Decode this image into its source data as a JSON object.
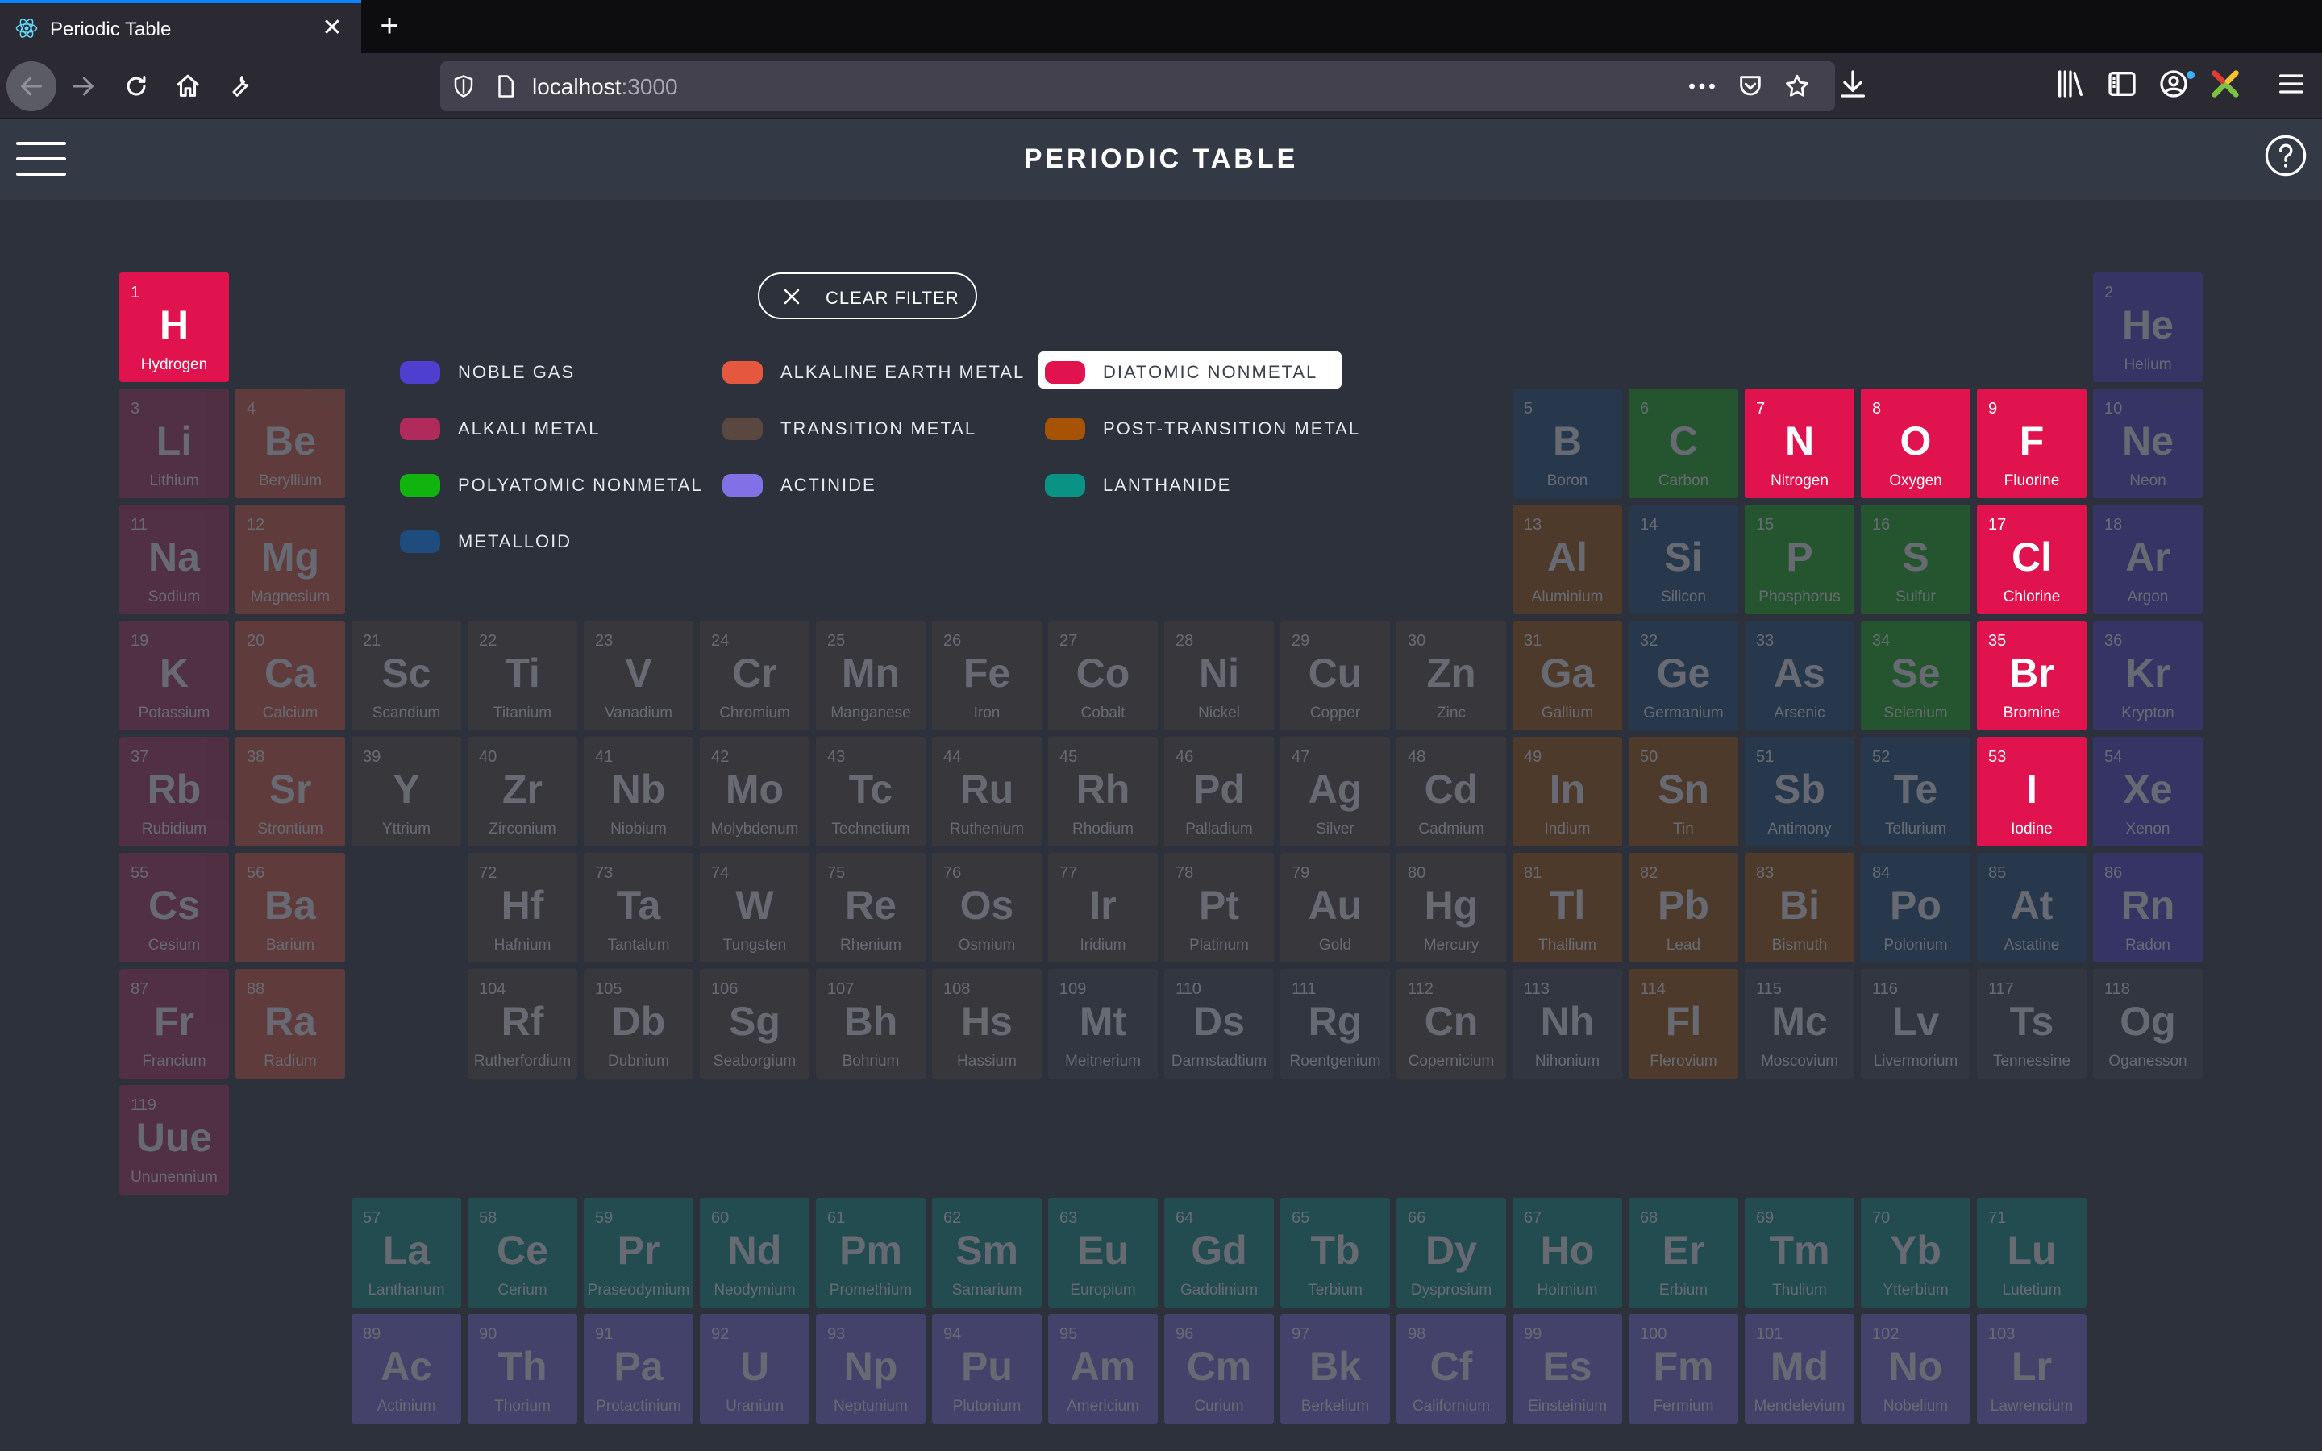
{
  "browser": {
    "tab_title": "Periodic Table",
    "url_host": "localhost",
    "url_port": ":3000"
  },
  "app": {
    "title": "PERIODIC TABLE",
    "menu_icon": "hamburger-icon",
    "help_icon": "help-icon"
  },
  "filter": {
    "clear_label": "CLEAR FILTER",
    "active_category": "DIATOMIC NONMETAL"
  },
  "legend": [
    {
      "label": "NOBLE GAS",
      "color": "#4f3fd0"
    },
    {
      "label": "ALKALINE EARTH METAL",
      "color": "#e5583f"
    },
    {
      "label": "DIATOMIC NONMETAL",
      "color": "#e0134e"
    },
    {
      "label": "ALKALI METAL",
      "color": "#b02a5b"
    },
    {
      "label": "TRANSITION METAL",
      "color": "#5a4840"
    },
    {
      "label": "POST-TRANSITION METAL",
      "color": "#a65305"
    },
    {
      "label": "POLYATOMIC NONMETAL",
      "color": "#11b30e"
    },
    {
      "label": "ACTINIDE",
      "color": "#8270e6"
    },
    {
      "label": "LANTHANIDE",
      "color": "#0a9384"
    },
    {
      "label": "METALLOID",
      "color": "#1d4c7d"
    }
  ],
  "category_colors": {
    "noble": "#4f3fd0",
    "alkaline": "#e5583f",
    "diatomic": "#e0134e",
    "alkali": "#b02a5b",
    "transition": "#5a4840",
    "post": "#a65305",
    "polyatomic": "#11b30e",
    "actinide": "#8270e6",
    "lanthanide": "#0a9384",
    "metalloid": "#1d4c7d",
    "unknown": "#3f4552"
  },
  "elements": [
    {
      "n": 1,
      "s": "H",
      "name": "Hydrogen",
      "c": "diatomic",
      "hl": true
    },
    {
      "n": 2,
      "s": "He",
      "name": "Helium",
      "c": "noble"
    },
    {
      "n": 3,
      "s": "Li",
      "name": "Lithium",
      "c": "alkali"
    },
    {
      "n": 4,
      "s": "Be",
      "name": "Beryllium",
      "c": "alkaline"
    },
    {
      "n": 5,
      "s": "B",
      "name": "Boron",
      "c": "metalloid"
    },
    {
      "n": 6,
      "s": "C",
      "name": "Carbon",
      "c": "polyatomic"
    },
    {
      "n": 7,
      "s": "N",
      "name": "Nitrogen",
      "c": "diatomic",
      "hl": true
    },
    {
      "n": 8,
      "s": "O",
      "name": "Oxygen",
      "c": "diatomic",
      "hl": true
    },
    {
      "n": 9,
      "s": "F",
      "name": "Fluorine",
      "c": "diatomic",
      "hl": true
    },
    {
      "n": 10,
      "s": "Ne",
      "name": "Neon",
      "c": "noble"
    },
    {
      "n": 11,
      "s": "Na",
      "name": "Sodium",
      "c": "alkali"
    },
    {
      "n": 12,
      "s": "Mg",
      "name": "Magnesium",
      "c": "alkaline"
    },
    {
      "n": 13,
      "s": "Al",
      "name": "Aluminium",
      "c": "post"
    },
    {
      "n": 14,
      "s": "Si",
      "name": "Silicon",
      "c": "metalloid"
    },
    {
      "n": 15,
      "s": "P",
      "name": "Phosphorus",
      "c": "polyatomic"
    },
    {
      "n": 16,
      "s": "S",
      "name": "Sulfur",
      "c": "polyatomic"
    },
    {
      "n": 17,
      "s": "Cl",
      "name": "Chlorine",
      "c": "diatomic",
      "hl": true
    },
    {
      "n": 18,
      "s": "Ar",
      "name": "Argon",
      "c": "noble"
    },
    {
      "n": 19,
      "s": "K",
      "name": "Potassium",
      "c": "alkali"
    },
    {
      "n": 20,
      "s": "Ca",
      "name": "Calcium",
      "c": "alkaline"
    },
    {
      "n": 21,
      "s": "Sc",
      "name": "Scandium",
      "c": "transition"
    },
    {
      "n": 22,
      "s": "Ti",
      "name": "Titanium",
      "c": "transition"
    },
    {
      "n": 23,
      "s": "V",
      "name": "Vanadium",
      "c": "transition"
    },
    {
      "n": 24,
      "s": "Cr",
      "name": "Chromium",
      "c": "transition"
    },
    {
      "n": 25,
      "s": "Mn",
      "name": "Manganese",
      "c": "transition"
    },
    {
      "n": 26,
      "s": "Fe",
      "name": "Iron",
      "c": "transition"
    },
    {
      "n": 27,
      "s": "Co",
      "name": "Cobalt",
      "c": "transition"
    },
    {
      "n": 28,
      "s": "Ni",
      "name": "Nickel",
      "c": "transition"
    },
    {
      "n": 29,
      "s": "Cu",
      "name": "Copper",
      "c": "transition"
    },
    {
      "n": 30,
      "s": "Zn",
      "name": "Zinc",
      "c": "transition"
    },
    {
      "n": 31,
      "s": "Ga",
      "name": "Gallium",
      "c": "post"
    },
    {
      "n": 32,
      "s": "Ge",
      "name": "Germanium",
      "c": "metalloid"
    },
    {
      "n": 33,
      "s": "As",
      "name": "Arsenic",
      "c": "metalloid"
    },
    {
      "n": 34,
      "s": "Se",
      "name": "Selenium",
      "c": "polyatomic"
    },
    {
      "n": 35,
      "s": "Br",
      "name": "Bromine",
      "c": "diatomic",
      "hl": true
    },
    {
      "n": 36,
      "s": "Kr",
      "name": "Krypton",
      "c": "noble"
    },
    {
      "n": 37,
      "s": "Rb",
      "name": "Rubidium",
      "c": "alkali"
    },
    {
      "n": 38,
      "s": "Sr",
      "name": "Strontium",
      "c": "alkaline"
    },
    {
      "n": 39,
      "s": "Y",
      "name": "Yttrium",
      "c": "transition"
    },
    {
      "n": 40,
      "s": "Zr",
      "name": "Zirconium",
      "c": "transition"
    },
    {
      "n": 41,
      "s": "Nb",
      "name": "Niobium",
      "c": "transition"
    },
    {
      "n": 42,
      "s": "Mo",
      "name": "Molybdenum",
      "c": "transition"
    },
    {
      "n": 43,
      "s": "Tc",
      "name": "Technetium",
      "c": "transition"
    },
    {
      "n": 44,
      "s": "Ru",
      "name": "Ruthenium",
      "c": "transition"
    },
    {
      "n": 45,
      "s": "Rh",
      "name": "Rhodium",
      "c": "transition"
    },
    {
      "n": 46,
      "s": "Pd",
      "name": "Palladium",
      "c": "transition"
    },
    {
      "n": 47,
      "s": "Ag",
      "name": "Silver",
      "c": "transition"
    },
    {
      "n": 48,
      "s": "Cd",
      "name": "Cadmium",
      "c": "transition"
    },
    {
      "n": 49,
      "s": "In",
      "name": "Indium",
      "c": "post"
    },
    {
      "n": 50,
      "s": "Sn",
      "name": "Tin",
      "c": "post"
    },
    {
      "n": 51,
      "s": "Sb",
      "name": "Antimony",
      "c": "metalloid"
    },
    {
      "n": 52,
      "s": "Te",
      "name": "Tellurium",
      "c": "metalloid"
    },
    {
      "n": 53,
      "s": "I",
      "name": "Iodine",
      "c": "diatomic",
      "hl": true
    },
    {
      "n": 54,
      "s": "Xe",
      "name": "Xenon",
      "c": "noble"
    },
    {
      "n": 55,
      "s": "Cs",
      "name": "Cesium",
      "c": "alkali"
    },
    {
      "n": 56,
      "s": "Ba",
      "name": "Barium",
      "c": "alkaline"
    },
    {
      "n": 72,
      "s": "Hf",
      "name": "Hafnium",
      "c": "transition"
    },
    {
      "n": 73,
      "s": "Ta",
      "name": "Tantalum",
      "c": "transition"
    },
    {
      "n": 74,
      "s": "W",
      "name": "Tungsten",
      "c": "transition"
    },
    {
      "n": 75,
      "s": "Re",
      "name": "Rhenium",
      "c": "transition"
    },
    {
      "n": 76,
      "s": "Os",
      "name": "Osmium",
      "c": "transition"
    },
    {
      "n": 77,
      "s": "Ir",
      "name": "Iridium",
      "c": "transition"
    },
    {
      "n": 78,
      "s": "Pt",
      "name": "Platinum",
      "c": "transition"
    },
    {
      "n": 79,
      "s": "Au",
      "name": "Gold",
      "c": "transition"
    },
    {
      "n": 80,
      "s": "Hg",
      "name": "Mercury",
      "c": "transition"
    },
    {
      "n": 81,
      "s": "Tl",
      "name": "Thallium",
      "c": "post"
    },
    {
      "n": 82,
      "s": "Pb",
      "name": "Lead",
      "c": "post"
    },
    {
      "n": 83,
      "s": "Bi",
      "name": "Bismuth",
      "c": "post"
    },
    {
      "n": 84,
      "s": "Po",
      "name": "Polonium",
      "c": "metalloid"
    },
    {
      "n": 85,
      "s": "At",
      "name": "Astatine",
      "c": "metalloid"
    },
    {
      "n": 86,
      "s": "Rn",
      "name": "Radon",
      "c": "noble"
    },
    {
      "n": 87,
      "s": "Fr",
      "name": "Francium",
      "c": "alkali"
    },
    {
      "n": 88,
      "s": "Ra",
      "name": "Radium",
      "c": "alkaline"
    },
    {
      "n": 104,
      "s": "Rf",
      "name": "Rutherfordium",
      "c": "transition"
    },
    {
      "n": 105,
      "s": "Db",
      "name": "Dubnium",
      "c": "transition"
    },
    {
      "n": 106,
      "s": "Sg",
      "name": "Seaborgium",
      "c": "transition"
    },
    {
      "n": 107,
      "s": "Bh",
      "name": "Bohrium",
      "c": "transition"
    },
    {
      "n": 108,
      "s": "Hs",
      "name": "Hassium",
      "c": "transition"
    },
    {
      "n": 109,
      "s": "Mt",
      "name": "Meitnerium",
      "c": "unknown"
    },
    {
      "n": 110,
      "s": "Ds",
      "name": "Darmstadtium",
      "c": "unknown"
    },
    {
      "n": 111,
      "s": "Rg",
      "name": "Roentgenium",
      "c": "unknown"
    },
    {
      "n": 112,
      "s": "Cn",
      "name": "Copernicium",
      "c": "transition"
    },
    {
      "n": 113,
      "s": "Nh",
      "name": "Nihonium",
      "c": "unknown"
    },
    {
      "n": 114,
      "s": "Fl",
      "name": "Flerovium",
      "c": "post"
    },
    {
      "n": 115,
      "s": "Mc",
      "name": "Moscovium",
      "c": "unknown"
    },
    {
      "n": 116,
      "s": "Lv",
      "name": "Livermorium",
      "c": "unknown"
    },
    {
      "n": 117,
      "s": "Ts",
      "name": "Tennessine",
      "c": "unknown"
    },
    {
      "n": 118,
      "s": "Og",
      "name": "Oganesson",
      "c": "unknown"
    },
    {
      "n": 119,
      "s": "Uue",
      "name": "Ununennium",
      "c": "alkali"
    },
    {
      "n": 57,
      "s": "La",
      "name": "Lanthanum",
      "c": "lanthanide"
    },
    {
      "n": 58,
      "s": "Ce",
      "name": "Cerium",
      "c": "lanthanide"
    },
    {
      "n": 59,
      "s": "Pr",
      "name": "Praseodymium",
      "c": "lanthanide"
    },
    {
      "n": 60,
      "s": "Nd",
      "name": "Neodymium",
      "c": "lanthanide"
    },
    {
      "n": 61,
      "s": "Pm",
      "name": "Promethium",
      "c": "lanthanide"
    },
    {
      "n": 62,
      "s": "Sm",
      "name": "Samarium",
      "c": "lanthanide"
    },
    {
      "n": 63,
      "s": "Eu",
      "name": "Europium",
      "c": "lanthanide"
    },
    {
      "n": 64,
      "s": "Gd",
      "name": "Gadolinium",
      "c": "lanthanide"
    },
    {
      "n": 65,
      "s": "Tb",
      "name": "Terbium",
      "c": "lanthanide"
    },
    {
      "n": 66,
      "s": "Dy",
      "name": "Dysprosium",
      "c": "lanthanide"
    },
    {
      "n": 67,
      "s": "Ho",
      "name": "Holmium",
      "c": "lanthanide"
    },
    {
      "n": 68,
      "s": "Er",
      "name": "Erbium",
      "c": "lanthanide"
    },
    {
      "n": 69,
      "s": "Tm",
      "name": "Thulium",
      "c": "lanthanide"
    },
    {
      "n": 70,
      "s": "Yb",
      "name": "Ytterbium",
      "c": "lanthanide"
    },
    {
      "n": 71,
      "s": "Lu",
      "name": "Lutetium",
      "c": "lanthanide"
    },
    {
      "n": 89,
      "s": "Ac",
      "name": "Actinium",
      "c": "actinide"
    },
    {
      "n": 90,
      "s": "Th",
      "name": "Thorium",
      "c": "actinide"
    },
    {
      "n": 91,
      "s": "Pa",
      "name": "Protactinium",
      "c": "actinide"
    },
    {
      "n": 92,
      "s": "U",
      "name": "Uranium",
      "c": "actinide"
    },
    {
      "n": 93,
      "s": "Np",
      "name": "Neptunium",
      "c": "actinide"
    },
    {
      "n": 94,
      "s": "Pu",
      "name": "Plutonium",
      "c": "actinide"
    },
    {
      "n": 95,
      "s": "Am",
      "name": "Americium",
      "c": "actinide"
    },
    {
      "n": 96,
      "s": "Cm",
      "name": "Curium",
      "c": "actinide"
    },
    {
      "n": 97,
      "s": "Bk",
      "name": "Berkelium",
      "c": "actinide"
    },
    {
      "n": 98,
      "s": "Cf",
      "name": "Californium",
      "c": "actinide"
    },
    {
      "n": 99,
      "s": "Es",
      "name": "Einsteinium",
      "c": "actinide"
    },
    {
      "n": 100,
      "s": "Fm",
      "name": "Fermium",
      "c": "actinide"
    },
    {
      "n": 101,
      "s": "Md",
      "name": "Mendelevium",
      "c": "actinide"
    },
    {
      "n": 102,
      "s": "No",
      "name": "Nobelium",
      "c": "actinide"
    },
    {
      "n": 103,
      "s": "Lr",
      "name": "Lawrencium",
      "c": "actinide"
    }
  ]
}
